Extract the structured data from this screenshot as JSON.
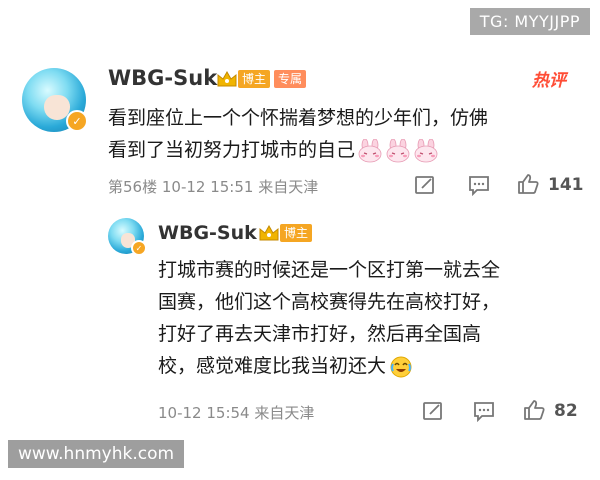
{
  "watermarks": {
    "top_right": "TG: MYYJJPP",
    "bottom_left": "www.hnmyhk.com"
  },
  "comment": {
    "username": "WBG-Suk",
    "badge_blogger": "博主",
    "badge_special": "专属",
    "hot_label": "热评",
    "text_line1": "看到座位上一个个怀揣着梦想的少年们，仿佛",
    "text_line2": "看到了当初努力打城市的自己",
    "emoji_count": 3,
    "meta": "第56楼 10-12 15:51 来自天津",
    "likes": "141"
  },
  "reply": {
    "username": "WBG-Suk",
    "badge_blogger": "博主",
    "lines": [
      "打城市赛的时候还是一个区打第一就去全",
      "国赛，他们这个高校赛得先在高校打好，",
      "打好了再去天津市打好，然后再全国高",
      "校，感觉难度比我当初还大"
    ],
    "meta": "10-12 15:54 来自天津",
    "likes": "82"
  },
  "icons": [
    "share-icon",
    "comment-icon",
    "like-icon",
    "verified-icon",
    "crown-icon",
    "rabbit-emoji-icon",
    "laugh-cry-emoji-icon"
  ],
  "colors": {
    "hot": "#ff4d36",
    "badge_orange": "#f5a623",
    "badge_special": "#ff8d5c",
    "meta_gray": "#8a8a8a"
  }
}
